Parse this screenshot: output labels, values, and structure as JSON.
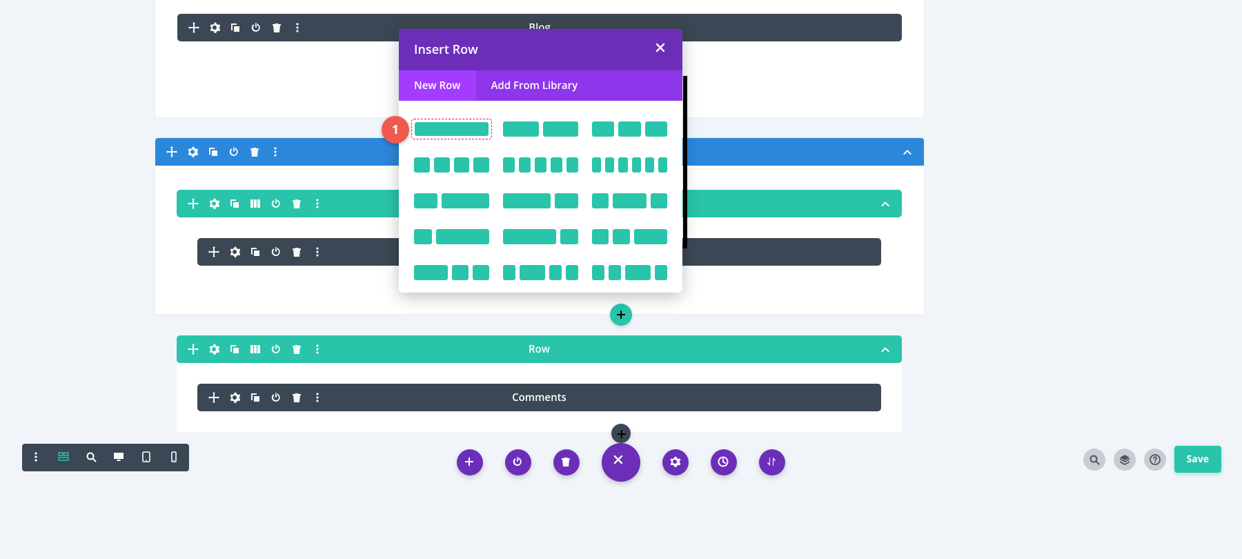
{
  "modules": {
    "blog": "Blog",
    "comments": "Comments"
  },
  "row_label": "Row",
  "modal": {
    "title": "Insert Row",
    "tab_new": "New Row",
    "tab_library": "Add From Library"
  },
  "step_badge": "1",
  "save_label": "Save",
  "layouts": [
    [
      1
    ],
    [
      1,
      1
    ],
    [
      1,
      1,
      1
    ],
    [
      1,
      1,
      1,
      1
    ],
    [
      1,
      1,
      1,
      1,
      1
    ],
    [
      1,
      1,
      1,
      1,
      1,
      1
    ],
    [
      1,
      2
    ],
    [
      2,
      1
    ],
    [
      1,
      2,
      1
    ],
    [
      1,
      3
    ],
    [
      3,
      1
    ],
    [
      1,
      1,
      2
    ],
    [
      2,
      1,
      1
    ],
    [
      1,
      2,
      1,
      1
    ],
    [
      1,
      1,
      2,
      1
    ]
  ]
}
